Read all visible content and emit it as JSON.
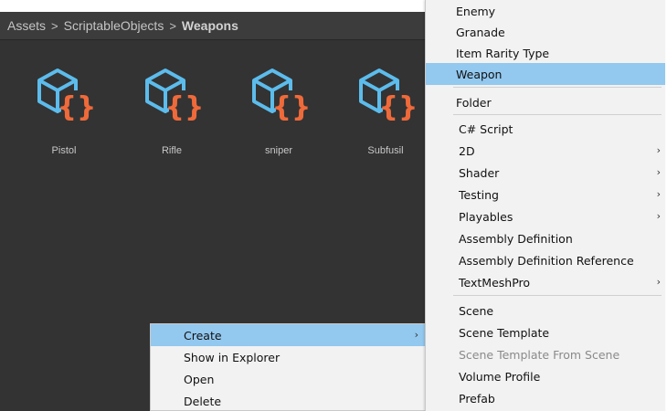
{
  "breadcrumb": {
    "items": [
      "Assets",
      "ScriptableObjects"
    ],
    "current": "Weapons",
    "separator": ">"
  },
  "assets": [
    {
      "name": "Pistol",
      "icon": "scriptable-object-icon"
    },
    {
      "name": "Rifle",
      "icon": "scriptable-object-icon"
    },
    {
      "name": "sniper",
      "icon": "scriptable-object-icon"
    },
    {
      "name": "Subfusil",
      "icon": "scriptable-object-icon"
    }
  ],
  "context_menu": {
    "items": [
      {
        "label": "Create",
        "highlighted": true,
        "submenu_arrow": "›"
      },
      {
        "label": "Show in Explorer"
      },
      {
        "label": "Open"
      },
      {
        "label": "Delete"
      }
    ]
  },
  "create_submenu": {
    "groups": [
      [
        {
          "label": "Enemy"
        },
        {
          "label": "Granade"
        },
        {
          "label": "Item Rarity Type"
        },
        {
          "label": "Weapon",
          "highlighted": true
        }
      ],
      [
        {
          "label": "Folder"
        }
      ],
      [
        {
          "label": "C# Script"
        },
        {
          "label": "2D",
          "submenu_arrow": "›"
        },
        {
          "label": "Shader",
          "submenu_arrow": "›"
        },
        {
          "label": "Testing",
          "submenu_arrow": "›"
        },
        {
          "label": "Playables",
          "submenu_arrow": "›"
        },
        {
          "label": "Assembly Definition"
        },
        {
          "label": "Assembly Definition Reference"
        },
        {
          "label": "TextMeshPro",
          "submenu_arrow": "›"
        }
      ],
      [
        {
          "label": "Scene"
        },
        {
          "label": "Scene Template"
        },
        {
          "label": "Scene Template From Scene",
          "disabled": true
        },
        {
          "label": "Volume Profile"
        },
        {
          "label": "Prefab"
        }
      ]
    ]
  },
  "colors": {
    "panel_bg": "#333333",
    "highlight": "#93c8ef",
    "icon_cube": "#5cbcec",
    "icon_braces": "#ef6a3a"
  }
}
